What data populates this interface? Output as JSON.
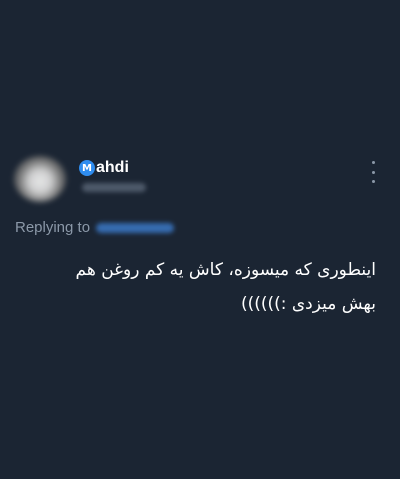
{
  "author": {
    "badge_letter": "M",
    "display_name": "ahdi"
  },
  "reply": {
    "label": "Replying to"
  },
  "tweet": {
    "line1": "اینطوری که میسوزه، کاش یه کم روغن هم",
    "line2": "بهش میزدی :))))))"
  },
  "colors": {
    "background": "#1b2533",
    "muted_text": "#8b98a8",
    "badge_blue": "#2f8df0"
  },
  "icons": {
    "more": "more-vertical-icon",
    "badge": "verified-badge-icon"
  }
}
